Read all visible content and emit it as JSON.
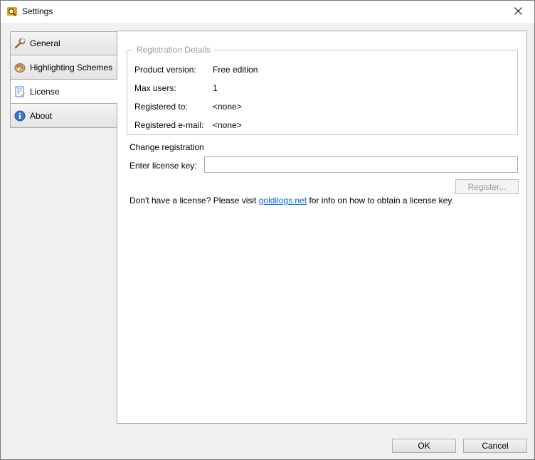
{
  "window": {
    "title": "Settings"
  },
  "tabs": [
    {
      "label": "General",
      "icon": "wrench-icon"
    },
    {
      "label": "Highlighting Schemes",
      "icon": "palette-icon"
    },
    {
      "label": "License",
      "icon": "license-icon",
      "active": true
    },
    {
      "label": "About",
      "icon": "info-icon"
    }
  ],
  "registration": {
    "legend": "Registration Details",
    "rows": [
      {
        "label": "Product version:",
        "value": "Free edition"
      },
      {
        "label": "Max users:",
        "value": "1"
      },
      {
        "label": "Registered to:",
        "value": "<none>"
      },
      {
        "label": "Registered e-mail:",
        "value": "<none>"
      }
    ]
  },
  "change": {
    "title": "Change registration",
    "key_label": "Enter license key:",
    "key_value": "",
    "register_label": "Register..."
  },
  "note": {
    "prefix": "Don't have a license? Please visit ",
    "link": "goldilogs.net",
    "suffix": " for info on how to obtain a license key."
  },
  "footer": {
    "ok": "OK",
    "cancel": "Cancel"
  }
}
